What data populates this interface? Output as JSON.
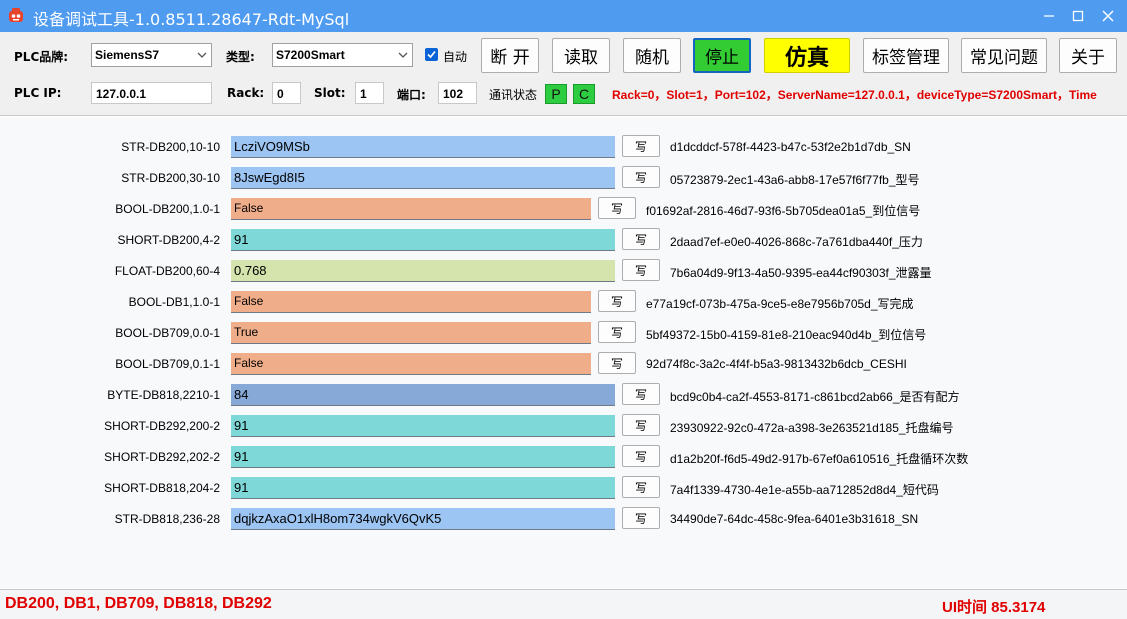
{
  "title": "设备调试工具-1.0.8511.28647-Rdt-MySql",
  "toolbar": {
    "brand_label": "PLC品牌:",
    "brand_value": "SiemensS7",
    "type_label": "类型:",
    "type_value": "S7200Smart",
    "auto_label": "自动",
    "auto_checked": true,
    "buttons": {
      "disconnect": "断 开",
      "read": "读取",
      "random": "随机",
      "stop": "停止",
      "simulate": "仿真",
      "tags": "标签管理",
      "faq": "常见问题",
      "about": "关于"
    },
    "ip_label": "PLC IP:",
    "ip_value": "127.0.0.1",
    "rack_label": "Rack:",
    "rack_value": "0",
    "slot_label": "Slot:",
    "slot_value": "1",
    "port_label": "端口:",
    "port_value": "102",
    "comm_label": "通讯状态",
    "status_p": "P",
    "status_c": "C",
    "info": "Rack=0，Slot=1，Port=102，ServerName=127.0.0.1，deviceType=S7200Smart，Time"
  },
  "colors": {
    "title_bar": "#4e9bf0",
    "stop_button": "#33cc33",
    "simulate_button": "#ffff00",
    "string_value": "#9cc5f3",
    "bool_value": "#f0ad8a",
    "short_value": "#7fd8d8",
    "float_value": "#d5e4ac",
    "byte_value": "#86a9d8",
    "status_text": "#e00000"
  },
  "rows": [
    {
      "label": "STR-DB200,10-10",
      "value": "LcziVO9MSb",
      "write": "写",
      "desc": "d1dcddcf-578f-4423-b47c-53f2e2b1d7db_SN",
      "kind": "string"
    },
    {
      "label": "STR-DB200,30-10",
      "value": "8JswEgd8I5",
      "write": "写",
      "desc": "05723879-2ec1-43a6-abb8-17e57f6f77fb_型号",
      "kind": "string"
    },
    {
      "label": "BOOL-DB200,1.0-1",
      "value": "False",
      "write": "写",
      "desc": "f01692af-2816-46d7-93f6-5b705dea01a5_到位信号",
      "kind": "bool"
    },
    {
      "label": "SHORT-DB200,4-2",
      "value": "91",
      "write": "写",
      "desc": "2daad7ef-e0e0-4026-868c-7a761dba440f_压力",
      "kind": "short"
    },
    {
      "label": "FLOAT-DB200,60-4",
      "value": "0.768",
      "write": "写",
      "desc": "7b6a04d9-9f13-4a50-9395-ea44cf90303f_泄露量",
      "kind": "float"
    },
    {
      "label": "BOOL-DB1,1.0-1",
      "value": "False",
      "write": "写",
      "desc": "e77a19cf-073b-475a-9ce5-e8e7956b705d_写完成",
      "kind": "bool"
    },
    {
      "label": "BOOL-DB709,0.0-1",
      "value": "True",
      "write": "写",
      "desc": "5bf49372-15b0-4159-81e8-210eac940d4b_到位信号",
      "kind": "bool"
    },
    {
      "label": "BOOL-DB709,0.1-1",
      "value": "False",
      "write": "写",
      "desc": "92d74f8c-3a2c-4f4f-b5a3-9813432b6dcb_CESHI",
      "kind": "bool"
    },
    {
      "label": "BYTE-DB818,2210-1",
      "value": "84",
      "write": "写",
      "desc": "bcd9c0b4-ca2f-4553-8171-c861bcd2ab66_是否有配方",
      "kind": "byte"
    },
    {
      "label": "SHORT-DB292,200-2",
      "value": "91",
      "write": "写",
      "desc": "23930922-92c0-472a-a398-3e263521d185_托盘编号",
      "kind": "short"
    },
    {
      "label": "SHORT-DB292,202-2",
      "value": "91",
      "write": "写",
      "desc": "d1a2b20f-f6d5-49d2-917b-67ef0a610516_托盘循环次数",
      "kind": "short"
    },
    {
      "label": "SHORT-DB818,204-2",
      "value": "91",
      "write": "写",
      "desc": "7a4f1339-4730-4e1e-a55b-aa712852d8d4_短代码",
      "kind": "short"
    },
    {
      "label": "STR-DB818,236-28",
      "value": "dqjkzAxaO1xlH8om734wgkV6QvK5",
      "write": "写",
      "desc": "34490de7-64dc-458c-9fea-6401e3b31618_SN",
      "kind": "string"
    }
  ],
  "statusbar": {
    "db_list": "DB200, DB1, DB709, DB818, DB292",
    "ui_time": "UI时间  85.3174"
  }
}
